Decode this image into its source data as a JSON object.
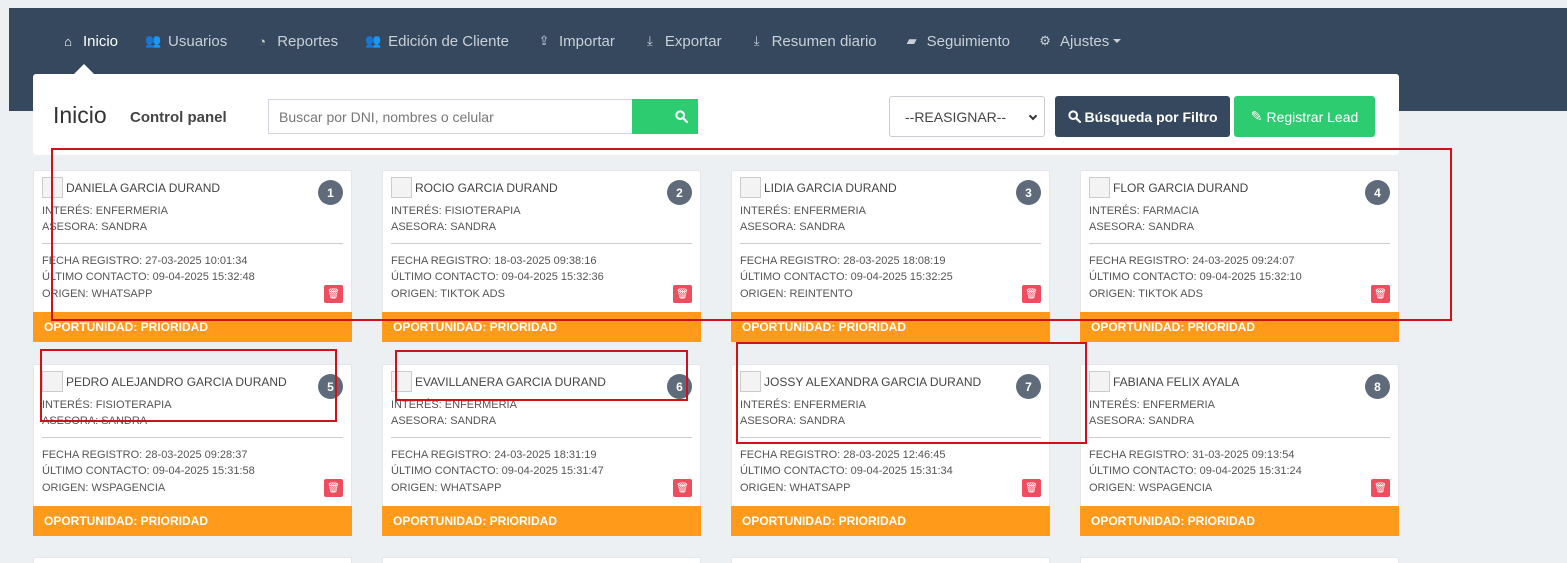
{
  "nav": {
    "items": [
      {
        "label": "Inicio",
        "icon": "home-icon"
      },
      {
        "label": "Usuarios",
        "icon": "users-icon"
      },
      {
        "label": "Reportes",
        "icon": "pie-chart-icon"
      },
      {
        "label": "Edición de Cliente",
        "icon": "users-icon"
      },
      {
        "label": "Importar",
        "icon": "upload-icon"
      },
      {
        "label": "Exportar",
        "icon": "download-icon"
      },
      {
        "label": "Resumen diario",
        "icon": "download-icon"
      },
      {
        "label": "Seguimiento",
        "icon": "book-icon"
      },
      {
        "label": "Ajustes",
        "icon": "gear-icon"
      }
    ]
  },
  "header": {
    "title": "Inicio",
    "subtitle": "Control panel",
    "search_placeholder": "Buscar por DNI, nombres o celular",
    "reassign_selected": "--REASIGNAR--",
    "filter_label": "Búsqueda por Filtro",
    "register_label": "Registrar Lead"
  },
  "cards": [
    {
      "num": "1",
      "name": "DANIELA GARCIA DURAND",
      "interes": "INTERÉS: ENFERMERIA",
      "asesora": "ASESORA: SANDRA",
      "registro": "FECHA REGISTRO: 27-03-2025 10:01:34",
      "contacto": "ÚLTIMO CONTACTO: 09-04-2025 15:32:48",
      "origen": "ORIGEN: WHATSAPP",
      "status": "OPORTUNIDAD: PRIORIDAD"
    },
    {
      "num": "2",
      "name": "ROCIO GARCIA DURAND",
      "interes": "INTERÉS: FISIOTERAPIA",
      "asesora": "ASESORA: SANDRA",
      "registro": "FECHA REGISTRO: 18-03-2025 09:38:16",
      "contacto": "ÚLTIMO CONTACTO: 09-04-2025 15:32:36",
      "origen": "ORIGEN: TIKTOK ADS",
      "status": "OPORTUNIDAD: PRIORIDAD"
    },
    {
      "num": "3",
      "name": "LIDIA GARCIA DURAND",
      "interes": "INTERÉS: ENFERMERIA",
      "asesora": "ASESORA: SANDRA",
      "registro": "FECHA REGISTRO: 28-03-2025 18:08:19",
      "contacto": "ÚLTIMO CONTACTO: 09-04-2025 15:32:25",
      "origen": "ORIGEN: REINTENTO",
      "status": "OPORTUNIDAD: PRIORIDAD"
    },
    {
      "num": "4",
      "name": "FLOR GARCIA DURAND",
      "interes": "INTERÉS: FARMACIA",
      "asesora": "ASESORA: SANDRA",
      "registro": "FECHA REGISTRO: 24-03-2025 09:24:07",
      "contacto": "ÚLTIMO CONTACTO: 09-04-2025 15:32:10",
      "origen": "ORIGEN: TIKTOK ADS",
      "status": "OPORTUNIDAD: PRIORIDAD"
    },
    {
      "num": "5",
      "name": "PEDRO ALEJANDRO GARCIA DURAND",
      "interes": "INTERÉS: FISIOTERAPIA",
      "asesora": "ASESORA: SANDRA",
      "registro": "FECHA REGISTRO: 28-03-2025 09:28:37",
      "contacto": "ÚLTIMO CONTACTO: 09-04-2025 15:31:58",
      "origen": "ORIGEN: WSPAGENCIA",
      "status": "OPORTUNIDAD: PRIORIDAD"
    },
    {
      "num": "6",
      "name": "EVAVILLANERA GARCIA DURAND",
      "interes": "INTERÉS: ENFERMERIA",
      "asesora": "ASESORA: SANDRA",
      "registro": "FECHA REGISTRO: 24-03-2025 18:31:19",
      "contacto": "ÚLTIMO CONTACTO: 09-04-2025 15:31:47",
      "origen": "ORIGEN: WHATSAPP",
      "status": "OPORTUNIDAD: PRIORIDAD"
    },
    {
      "num": "7",
      "name": "JOSSY ALEXANDRA GARCIA DURAND",
      "interes": "INTERÉS: ENFERMERIA",
      "asesora": "ASESORA: SANDRA",
      "registro": "FECHA REGISTRO: 28-03-2025 12:46:45",
      "contacto": "ÚLTIMO CONTACTO: 09-04-2025 15:31:34",
      "origen": "ORIGEN: WHATSAPP",
      "status": "OPORTUNIDAD: PRIORIDAD"
    },
    {
      "num": "8",
      "name": "FABIANA FELIX AYALA",
      "interes": "INTERÉS: ENFERMERIA",
      "asesora": "ASESORA: SANDRA",
      "registro": "FECHA REGISTRO: 31-03-2025 09:13:54",
      "contacto": "ÚLTIMO CONTACTO: 09-04-2025 15:31:24",
      "origen": "ORIGEN: WSPAGENCIA",
      "status": "OPORTUNIDAD: PRIORIDAD"
    }
  ],
  "colors": {
    "navbar": "#36485d",
    "green": "#2ecc71",
    "orange": "#ff9a1a",
    "delete_red": "#ef4d5e",
    "annotation_red": "#d0101a"
  }
}
